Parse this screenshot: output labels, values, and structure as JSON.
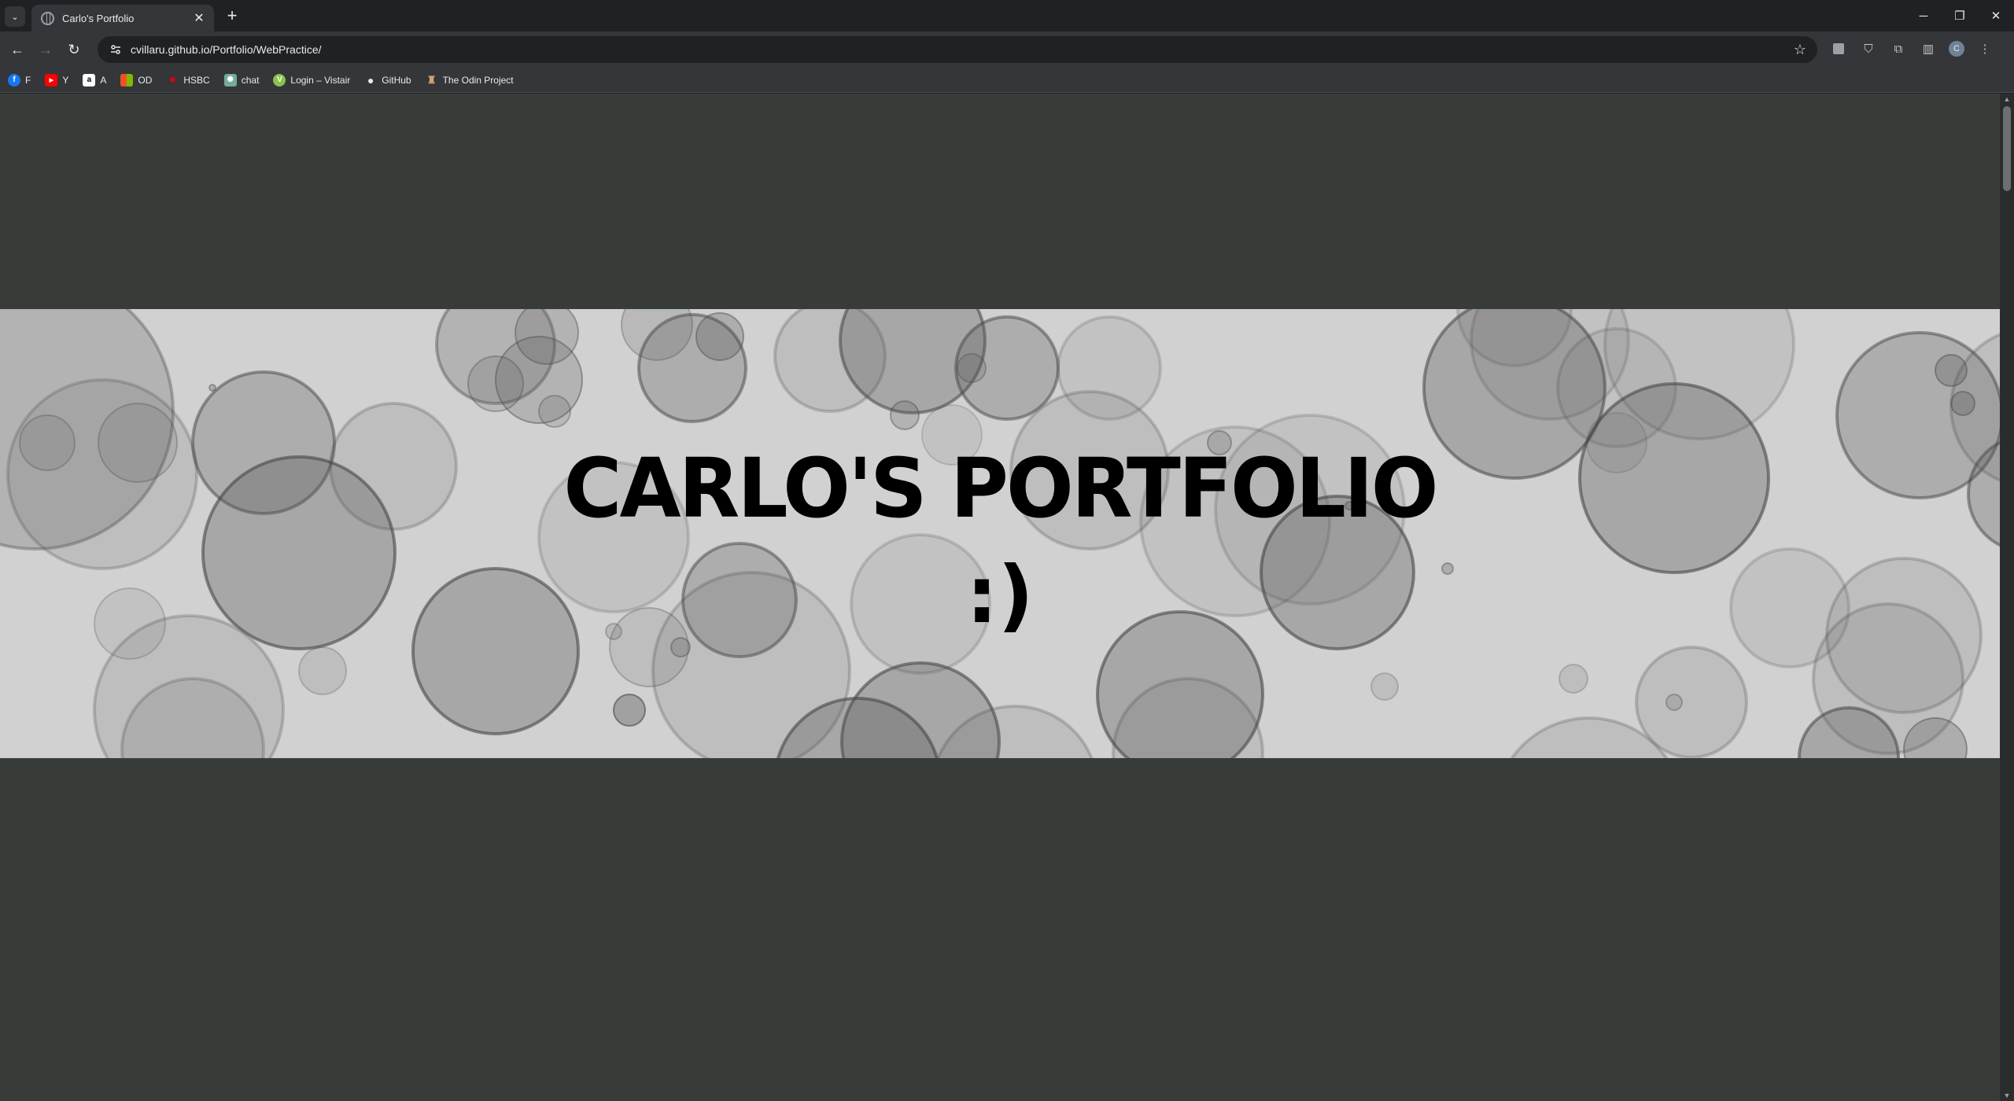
{
  "browser": {
    "tab": {
      "title": "Carlo's Portfolio",
      "close": "✕"
    },
    "new_tab": "+",
    "window_controls": {
      "minimize": "─",
      "restore": "❐",
      "close": "✕"
    },
    "nav": {
      "back": "←",
      "forward": "→",
      "reload": "↻"
    },
    "omnibox": {
      "url": "cvillaru.github.io/Portfolio/WebPractice/",
      "bookmark_star": "☆"
    },
    "profile_initial": "C"
  },
  "bookmarks": [
    {
      "label": "F",
      "icon": "facebook-icon",
      "color": "#1877f2",
      "glyph": "f"
    },
    {
      "label": "Y",
      "icon": "youtube-icon",
      "color": "#ff0000",
      "glyph": "▶"
    },
    {
      "label": "A",
      "icon": "amazon-icon",
      "color": "#ffffff",
      "glyph": "a"
    },
    {
      "label": "OD",
      "icon": "microsoft-icon",
      "color": "#f25022",
      "glyph": ""
    },
    {
      "label": "HSBC",
      "icon": "hsbc-icon",
      "color": "#db0011",
      "glyph": "◆"
    },
    {
      "label": "chat",
      "icon": "chatgpt-icon",
      "color": "#74aa9c",
      "glyph": "✺"
    },
    {
      "label": "Login – Vistair",
      "icon": "vistair-icon",
      "color": "#8bc34a",
      "glyph": "V"
    },
    {
      "label": "GitHub",
      "icon": "github-icon",
      "color": "#e8eaed",
      "glyph": "●"
    },
    {
      "label": "The Odin Project",
      "icon": "odin-project-icon",
      "color": "#d4a373",
      "glyph": "♜"
    }
  ],
  "page": {
    "hero_title": "CARLO'S PORTFOLIO",
    "hero_face": ":)",
    "background_color": "#373c39",
    "hero_color": "#d1d1d1"
  }
}
